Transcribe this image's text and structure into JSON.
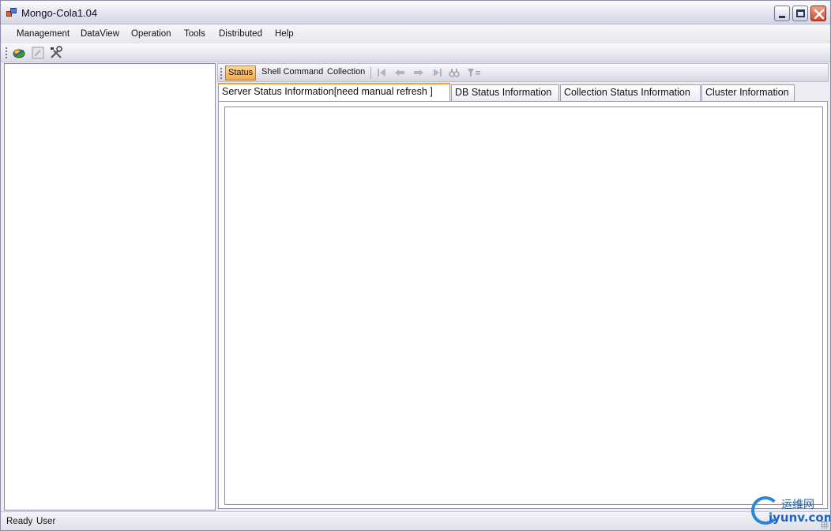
{
  "window": {
    "title": "Mongo-Cola1.04"
  },
  "menubar": {
    "items": [
      {
        "label": "Management"
      },
      {
        "label": "DataView"
      },
      {
        "label": "Operation"
      },
      {
        "label": "Tools"
      },
      {
        "label": "Distributed"
      },
      {
        "label": "Help"
      }
    ]
  },
  "toolbar": {
    "icons": [
      "connect-icon",
      "edit-icon",
      "tools-icon"
    ]
  },
  "sub_toolbar": {
    "buttons": [
      {
        "label": "Status",
        "active": true
      },
      {
        "label": "Shell Command",
        "active": false
      },
      {
        "label": "Collection",
        "active": false
      }
    ],
    "nav_icons": [
      "first-page-icon",
      "previous-page-icon",
      "next-page-icon",
      "last-page-icon",
      "query-icon",
      "filter-icon"
    ]
  },
  "tabs": [
    {
      "label": "Server Status Information[need manual refresh ]",
      "selected": true
    },
    {
      "label": "DB Status Information",
      "selected": false
    },
    {
      "label": "Collection Status Information",
      "selected": false
    },
    {
      "label": "Cluster Information",
      "selected": false
    }
  ],
  "statusbar": {
    "status": "Ready",
    "user_label": "User"
  },
  "watermark": {
    "cn": "运维网",
    "en": "iyunv.com"
  },
  "colors": {
    "active_tab_accent": "#f0a030",
    "active_button": "#f6a93f",
    "close_button": "#d2452a"
  }
}
